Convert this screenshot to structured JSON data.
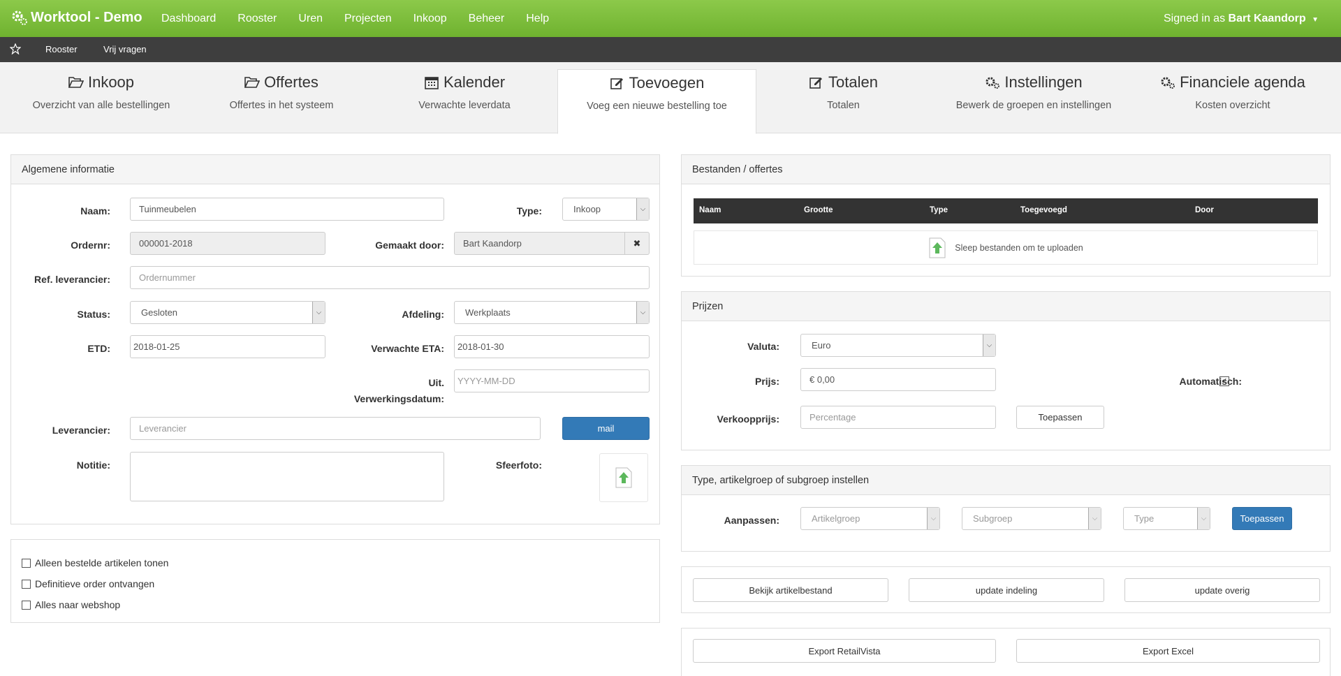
{
  "app": {
    "title": "Worktool - Demo",
    "user_prefix": "Signed in as ",
    "user_name": "Bart Kaandorp"
  },
  "nav": [
    "Dashboard",
    "Rooster",
    "Uren",
    "Projecten",
    "Inkoop",
    "Beheer",
    "Help"
  ],
  "subnav": [
    "Rooster",
    "Vrij vragen"
  ],
  "tabs": [
    {
      "title": "Inkoop",
      "sub": "Overzicht van alle bestellingen",
      "icon": "folder-open-icon"
    },
    {
      "title": "Offertes",
      "sub": "Offertes in het systeem",
      "icon": "folder-open-icon"
    },
    {
      "title": "Kalender",
      "sub": "Verwachte leverdata",
      "icon": "calendar-icon"
    },
    {
      "title": "Toevoegen",
      "sub": "Voeg een nieuwe bestelling toe",
      "icon": "edit-icon"
    },
    {
      "title": "Totalen",
      "sub": "Totalen",
      "icon": "edit-icon"
    },
    {
      "title": "Instellingen",
      "sub": "Bewerk de groepen en instellingen",
      "icon": "gears-icon"
    },
    {
      "title": "Financiele agenda",
      "sub": "Kosten overzicht",
      "icon": "gears-icon"
    }
  ],
  "general": {
    "title": "Algemene informatie",
    "naam_label": "Naam:",
    "naam": "Tuinmeubelen",
    "type_label": "Type:",
    "type": "Inkoop",
    "ordernr_label": "Ordernr:",
    "ordernr": "000001-2018",
    "gemaakt_label": "Gemaakt door:",
    "gemaakt": "Bart Kaandorp",
    "ref_label": "Ref. leverancier:",
    "ref_placeholder": "Ordernummer",
    "status_label": "Status:",
    "status": "Gesloten",
    "afdeling_label": "Afdeling:",
    "afdeling": "Werkplaats",
    "etd_label": "ETD:",
    "etd": "2018-01-25",
    "eta_label": "Verwachte ETA:",
    "eta": "2018-01-30",
    "uit_label1": "Uit.",
    "uit_label2": "Verwerkingsdatum:",
    "uit_placeholder": "YYYY-MM-DD",
    "lev_label": "Leverancier:",
    "lev_placeholder": "Leverancier",
    "mail": "mail",
    "notitie_label": "Notitie:",
    "sfeer_label": "Sfeerfoto:"
  },
  "checks": [
    "Alleen bestelde artikelen tonen",
    "Definitieve order ontvangen",
    "Alles naar webshop"
  ],
  "files": {
    "title": "Bestanden / offertes",
    "cols": [
      "Naam",
      "Grootte",
      "Type",
      "Toegevoegd",
      "Door"
    ],
    "drop": "Sleep bestanden om te uploaden"
  },
  "prices": {
    "title": "Prijzen",
    "valuta_label": "Valuta:",
    "valuta": "Euro",
    "prijs_label": "Prijs:",
    "prijs": "€ 0,00",
    "auto_label": "Automatisch:",
    "verkoop_label": "Verkoopprijs:",
    "verkoop_placeholder": "Percentage",
    "apply": "Toepassen"
  },
  "group": {
    "title": "Type, artikelgroep of subgroep instellen",
    "label": "Aanpassen:",
    "g1": "Artikelgroep",
    "g2": "Subgroep",
    "g3": "Type",
    "apply": "Toepassen"
  },
  "actions": [
    "Bekijk artikelbestand",
    "update indeling",
    "update overig"
  ],
  "exports": [
    "Export RetailVista",
    "Export Excel"
  ]
}
